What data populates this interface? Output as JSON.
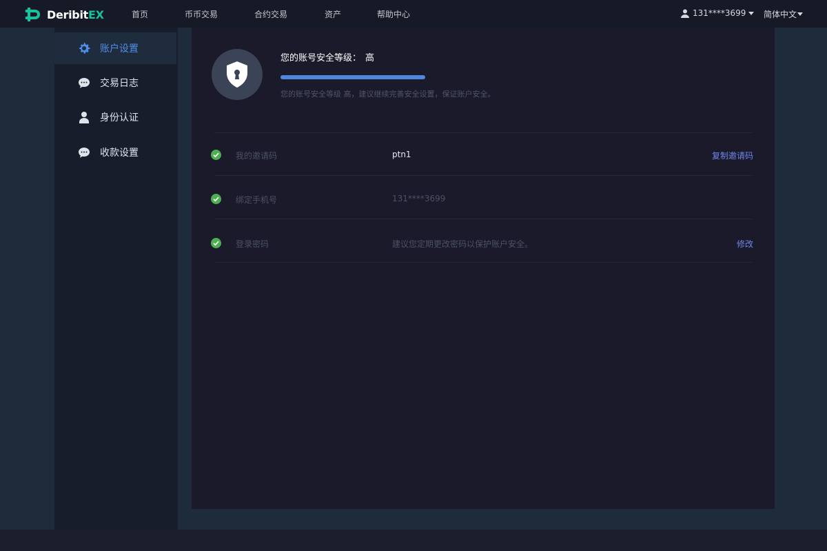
{
  "brand": {
    "name_main": "Deribit",
    "name_accent": "EX"
  },
  "nav": [
    {
      "label": "首页"
    },
    {
      "label": "币币交易"
    },
    {
      "label": "合约交易"
    },
    {
      "label": "资产"
    },
    {
      "label": "帮助中心"
    }
  ],
  "user": {
    "phone": "131****3699",
    "language": "简体中文"
  },
  "sidebar": {
    "items": [
      {
        "label": "账户设置",
        "icon": "gear-icon",
        "active": true
      },
      {
        "label": "交易日志",
        "icon": "chat-bubble-icon",
        "active": false
      },
      {
        "label": "身份认证",
        "icon": "person-icon",
        "active": false
      },
      {
        "label": "收款设置",
        "icon": "chat-bubble-icon",
        "active": false
      }
    ]
  },
  "security": {
    "title": "您的账号安全等级：",
    "level": "高",
    "progress_percent": 100,
    "note": "您的账号安全等级 高，建议继续完善安全设置，保证账户安全。"
  },
  "rows": [
    {
      "label": "我的邀请码",
      "value": "ptn1",
      "action": "复制邀请码"
    },
    {
      "label": "绑定手机号",
      "value": "131****3699",
      "action": ""
    },
    {
      "label": "登录密码",
      "value": "建议您定期更改密码以保护账户安全。",
      "action": "修改"
    }
  ],
  "colors": {
    "topbar": "#161a26",
    "panel": "#1a1a2b",
    "accent_blue": "#4d86df",
    "brand_green": "#18c29c",
    "check_green": "#4caf50"
  }
}
